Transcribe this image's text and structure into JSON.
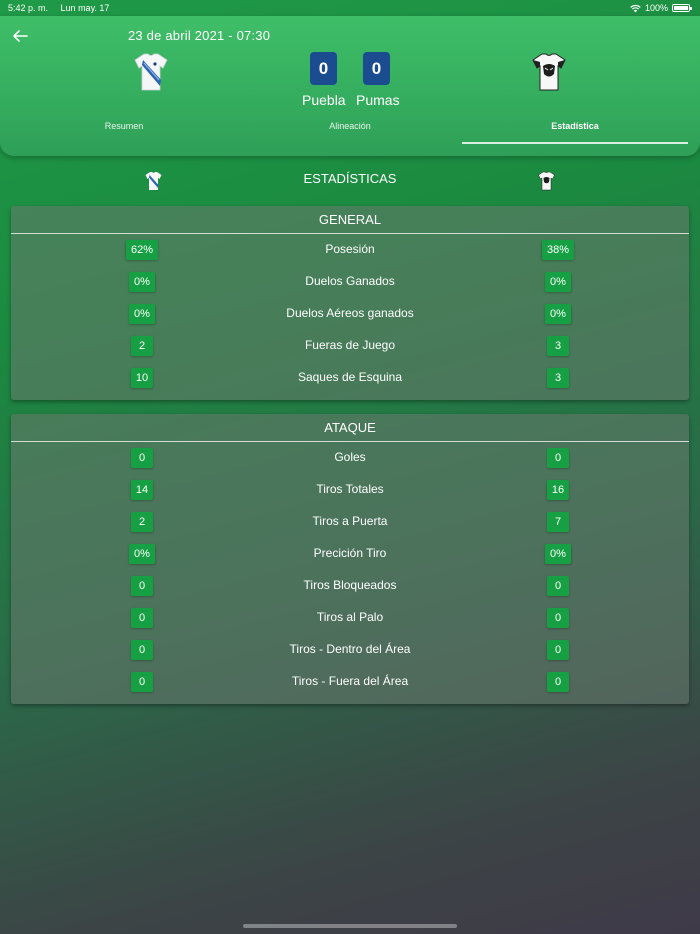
{
  "status_bar": {
    "time": "5:42 p. m.",
    "date": "Lun may. 17",
    "battery": "100%"
  },
  "match": {
    "datetime": "23 de abril 2021 - 07:30",
    "home_team": "Puebla",
    "away_team": "Pumas",
    "home_score": "0",
    "away_score": "0"
  },
  "tabs": {
    "resumen": "Resumen",
    "alineacion": "Alineación",
    "estadistica": "Estadística",
    "active": "estadistica"
  },
  "stats_title": "ESTADÍSTICAS",
  "sections": [
    {
      "title": "GENERAL",
      "rows": [
        {
          "label": "Posesión",
          "home": "62%",
          "away": "38%"
        },
        {
          "label": "Duelos Ganados",
          "home": "0%",
          "away": "0%"
        },
        {
          "label": "Duelos Aéreos ganados",
          "home": "0%",
          "away": "0%"
        },
        {
          "label": "Fueras de Juego",
          "home": "2",
          "away": "3"
        },
        {
          "label": "Saques de Esquina",
          "home": "10",
          "away": "3"
        }
      ]
    },
    {
      "title": "ATAQUE",
      "rows": [
        {
          "label": "Goles",
          "home": "0",
          "away": "0"
        },
        {
          "label": "Tiros Totales",
          "home": "14",
          "away": "16"
        },
        {
          "label": "Tiros a Puerta",
          "home": "2",
          "away": "7"
        },
        {
          "label": "Precición Tiro",
          "home": "0%",
          "away": "0%"
        },
        {
          "label": "Tiros Bloqueados",
          "home": "0",
          "away": "0"
        },
        {
          "label": "Tiros al Palo",
          "home": "0",
          "away": "0"
        },
        {
          "label": "Tiros - Dentro del Área",
          "home": "0",
          "away": "0"
        },
        {
          "label": "Tiros - Fuera del Área",
          "home": "0",
          "away": "0"
        }
      ]
    }
  ],
  "colors": {
    "accent": "#16a043",
    "score_bg": "#1a4c8f",
    "header_bg": "#3fbe68"
  },
  "icons": {
    "back": "arrow-left-icon",
    "wifi": "wifi-icon",
    "battery": "battery-icon",
    "home_shirt": "puebla-jersey-icon",
    "away_shirt": "pumas-jersey-icon"
  }
}
